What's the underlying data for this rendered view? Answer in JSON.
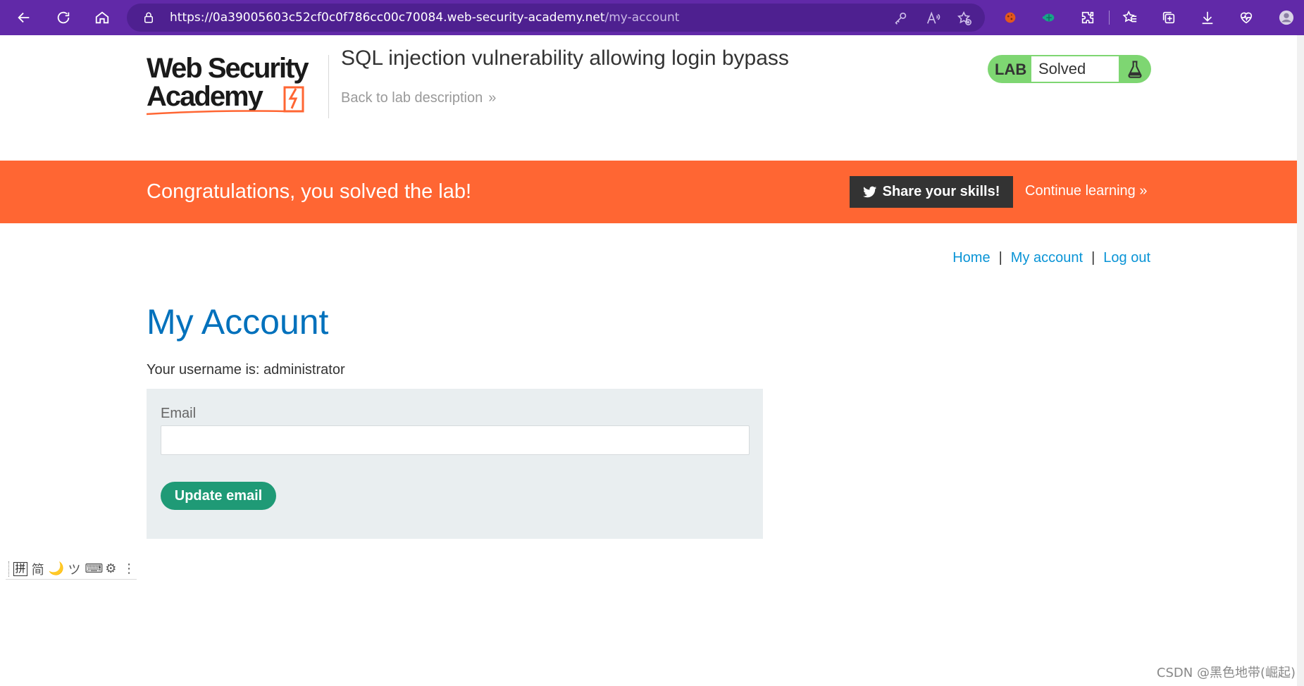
{
  "browser": {
    "url_host": "https://0a39005603c52cf0c0f786cc00c70084.web-security-academy.net",
    "url_path": "/my-account"
  },
  "header": {
    "logo_line1": "Web Security",
    "logo_line2": "Academy",
    "lab_title": "SQL injection vulnerability allowing login bypass",
    "back_link": "Back to lab description",
    "lab_badge_label": "LAB",
    "lab_status": "Solved"
  },
  "banner": {
    "message": "Congratulations, you solved the lab!",
    "share_button": "Share your skills!",
    "continue_link": "Continue learning"
  },
  "nav": {
    "home": "Home",
    "my_account": "My account",
    "log_out": "Log out",
    "separator": "|"
  },
  "account": {
    "title": "My Account",
    "username_line": "Your username is: administrator",
    "email_label": "Email",
    "email_value": "",
    "update_button": "Update email"
  },
  "ime": {
    "glyphs": [
      "拼",
      "简",
      "🌙",
      "ツ",
      "⌨",
      "⚙",
      "⋮"
    ]
  },
  "watermark": "CSDN @黑色地带(崛起)",
  "colors": {
    "browser_chrome": "#6129a8",
    "banner": "#ff6633",
    "lab_badge": "#7ed672",
    "title_blue": "#0071bc",
    "link_blue": "#0a94d6",
    "update_button": "#1f9a76"
  }
}
